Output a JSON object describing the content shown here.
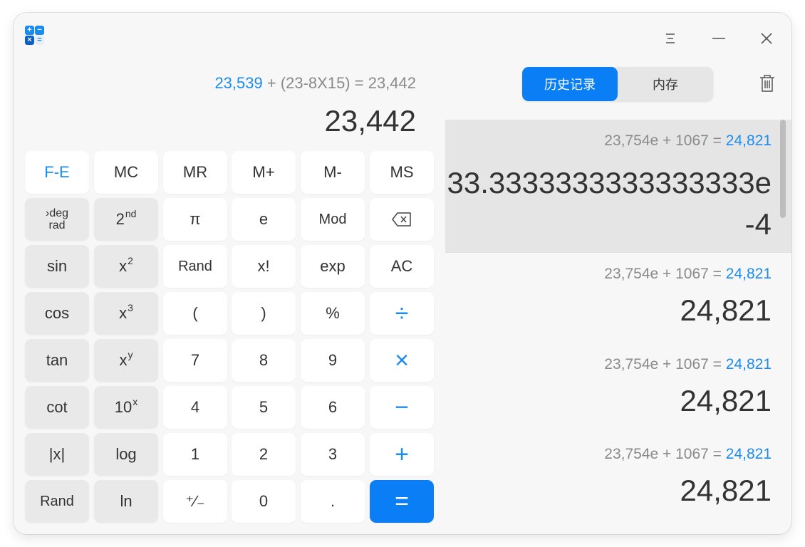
{
  "titlebar": {
    "icon_glyphs": [
      "+",
      "−",
      "×",
      "="
    ],
    "menu_icon": "menu-icon",
    "minimize_icon": "minimize-icon",
    "close_icon": "close-icon"
  },
  "display": {
    "expression_operand": "23,539",
    "expression_rest": " + (23-8X15) = 23,442",
    "result": "23,442"
  },
  "keys": {
    "fe": "F-E",
    "mc": "MC",
    "mr": "MR",
    "mplus": "M+",
    "mminus": "M-",
    "ms": "MS",
    "deg": "›deg",
    "rad": "rad",
    "second_base": "2",
    "second_sup": "nd",
    "pi": "π",
    "e": "e",
    "mod": "Mod",
    "sin": "sin",
    "x2_base": "x",
    "x2_sup": "2",
    "rand": "Rand",
    "fact": "x!",
    "exp": "exp",
    "ac": "AC",
    "cos": "cos",
    "x3_base": "x",
    "x3_sup": "3",
    "lparen": "(",
    "rparen": ")",
    "percent": "%",
    "divide": "÷",
    "tan": "tan",
    "xy_base": "x",
    "xy_sup": "y",
    "seven": "7",
    "eight": "8",
    "nine": "9",
    "multiply": "×",
    "cot": "cot",
    "tenx_base": "10",
    "tenx_sup": "x",
    "four": "4",
    "five": "5",
    "six": "6",
    "minus": "−",
    "abs": "|x|",
    "log": "log",
    "one": "1",
    "two": "2",
    "three": "3",
    "plus": "+",
    "rand2": "Rand",
    "ln": "ln",
    "plusminus": "⁺∕₋",
    "zero": "0",
    "dot": ".",
    "equals": "="
  },
  "tabs": {
    "history": "历史记录",
    "memory": "内存"
  },
  "history": [
    {
      "expr_a": "23,754e + 1067 = ",
      "expr_b": "24,821",
      "value": "33.3333333333333333e-4"
    },
    {
      "expr_a": "23,754e + 1067 = ",
      "expr_b": "24,821",
      "value": "24,821"
    },
    {
      "expr_a": "23,754e + 1067 = ",
      "expr_b": "24,821",
      "value": "24,821"
    },
    {
      "expr_a": "23,754e + 1067 = ",
      "expr_b": "24,821",
      "value": "24,821"
    }
  ],
  "colors": {
    "accent": "#0a7ff5",
    "accent_text": "#1a8cf0",
    "key_gray": "#e9e9e9",
    "window_bg": "#f7f7f7"
  }
}
